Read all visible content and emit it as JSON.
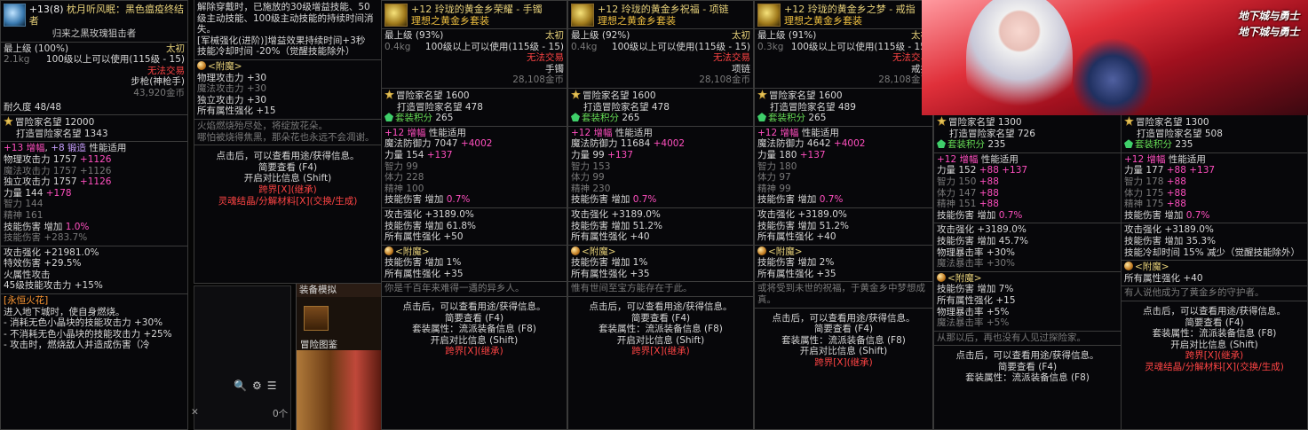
{
  "p1": {
    "title_prefix": "+13(8)",
    "title_name": "枕月听风眠：黑色瘟疫终结者",
    "subtitle": "归来之黑玫瑰狙击者",
    "level": "最上级",
    "level_pct": "(100%)",
    "grade": "太初",
    "weight": "2.1kg",
    "req": "100级以上可以使用(115级 - 15)",
    "trade": "无法交易",
    "type": "步枪(神枪手)",
    "price": "43,920金币",
    "durability": "耐久度 48/48",
    "fame_label": "冒险家名望",
    "fame": "12000",
    "craft_label": "打造冒险家名望",
    "craft": "1343",
    "enh_a": "+13",
    "enh_b": "增幅",
    "enh_c": "+8",
    "enh_d": "锻造",
    "enh_e": "性能适用",
    "stats": [
      {
        "k": "物理攻击力",
        "v": "1757",
        "b": "+1126"
      },
      {
        "k": "魔法攻击力",
        "v": "1757",
        "b": "+1126"
      },
      {
        "k": "独立攻击力",
        "v": "1757",
        "b": "+1126"
      },
      {
        "k": "力量",
        "v": "144",
        "b": "+178"
      },
      {
        "k": "智力",
        "v": "144",
        "b": ""
      },
      {
        "k": "精神",
        "v": "161",
        "b": ""
      }
    ],
    "skill_inc": "技能伤害  增加",
    "skill_inc_v": "1.0%",
    "skill_dmg": "技能伤害",
    "skill_dmg_v": "+283.7%",
    "atk_strong": "攻击强化  +21981.0%",
    "special_dmg": "特效伤害  +29.5%",
    "fire_atk": "火属性攻击",
    "lvl45": "45级技能攻击力  +15%",
    "section": "[永恒火花]",
    "desc1": "进入地下城时，使自身燃烧。",
    "desc2": "- 消耗无色小晶块的技能攻击力 +30%",
    "desc3": "- 不消耗无色小晶块的技能攻击力 +25%",
    "desc4": "- 攻击时，燃烧敌人并造成伤害（冷"
  },
  "p2": {
    "text1": "解除穿戴时，已施放的30级增益技能、50级主动技能、100级主动技能的持续时间消失。",
    "text2": "[军械强化(进阶)]增益效果持续时间+3秒",
    "text3": "技能冷却时间 -20%（觉醒技能除外）",
    "enchant": "<附魔>",
    "e1": "物理攻击力 +30",
    "e2": "魔法攻击力 +30",
    "e3": "独立攻击力 +30",
    "e4": "所有属性强化 +15",
    "flavor1": "火焰燃烧殆尽处，将绽放花朵。",
    "flavor2": "哪怕被烧得焦黑，那朵花也永远不会凋谢。",
    "click": "点击后，可以查看用途/获得信息。",
    "simple": "简要查看 (F4)",
    "compare": "开启对比信息 (Shift)",
    "cross": "跨界[X](继承)",
    "soul": "灵魂结晶/分解材料[X](交换/生成)",
    "equip_sim": "装备模拟",
    "adv_book": "冒险图鉴",
    "count": "0个"
  },
  "items": [
    {
      "title": "+12  玲珑的黄金乡荣耀 - 手镯",
      "set": "理想之黄金乡套装",
      "level_pct": "(93%)",
      "weight": "0.4kg",
      "req": "100级以上可以使用(115级 - 15)",
      "kind": "手镯",
      "price": "28,108金币",
      "fame": "1600",
      "craft": "478",
      "setpts": "265",
      "def_k": "魔法防御力",
      "def_v": "7047",
      "def_b": "+4002",
      "s1k": "力量",
      "s1v": "154",
      "s1b": "+137",
      "s2k": "智力",
      "s2v": "99",
      "s3k": "体力",
      "s3v": "228",
      "s4k": "精神",
      "s4v": "100",
      "skill": "0.7%",
      "atk": "攻击强化  +3189.0%",
      "dmg": "技能伤害  增加  61.8%",
      "all": "所有属性强化  +50",
      "en1": "技能伤害  增加  1%",
      "en2": "所有属性强化  +35",
      "flavor": "你是千百年来难得一遇的异乡人。"
    },
    {
      "title": "+12  玲珑的黄金乡祝福 - 项链",
      "set": "理想之黄金乡套装",
      "level_pct": "(92%)",
      "weight": "0.4kg",
      "req": "100级以上可以使用(115级 - 15)",
      "kind": "项链",
      "price": "28,108金币",
      "fame": "1600",
      "craft": "478",
      "setpts": "265",
      "def_k": "魔法防御力",
      "def_v": "11684",
      "def_b": "+4002",
      "s1k": "力量",
      "s1v": "99",
      "s1b": "+137",
      "s2k": "智力",
      "s2v": "153",
      "s3k": "体力",
      "s3v": "99",
      "s4k": "精神",
      "s4v": "230",
      "skill": "0.7%",
      "atk": "攻击强化  +3189.0%",
      "dmg": "技能伤害  增加  51.2%",
      "all": "所有属性强化  +40",
      "en1": "技能伤害  增加  1%",
      "en2": "所有属性强化  +35",
      "flavor": "惟有世间至宝方能存在于此。"
    },
    {
      "title": "+12  玲珑的黄金乡之梦 - 戒指",
      "set": "理想之黄金乡套装",
      "level_pct": "(91%)",
      "weight": "0.3kg",
      "req": "100级以上可以使用(115级 - 15)",
      "kind": "戒指",
      "price": "28,108金币",
      "fame": "1600",
      "craft": "489",
      "setpts": "265",
      "def_k": "魔法防御力",
      "def_v": "4642",
      "def_b": "+4002",
      "s1k": "力量",
      "s1v": "180",
      "s1b": "+137",
      "s2k": "智力",
      "s2v": "180",
      "s3k": "体力",
      "s3v": "97",
      "s4k": "精神",
      "s4v": "99",
      "skill": "0.7%",
      "atk": "攻击强化  +3189.0%",
      "dmg": "技能伤害  增加  51.2%",
      "all": "所有属性强化  +40",
      "en1": "技能伤害  增加  2%",
      "en2": "所有属性强化  +35",
      "flavor": "或将受到未世的祝福，于黄金乡中梦想成真。"
    }
  ],
  "p6": {
    "fame": "1300",
    "craft": "726",
    "setpts": "235",
    "enh": "+12",
    "stats": [
      {
        "k": "力量",
        "v": "152",
        "b": "+88  +137"
      },
      {
        "k": "智力",
        "v": "150",
        "b": "+88"
      },
      {
        "k": "体力",
        "v": "147",
        "b": "+88"
      },
      {
        "k": "精神",
        "v": "151",
        "b": "+88"
      }
    ],
    "skill": "0.7%",
    "atk": "攻击强化  +3189.0%",
    "dmg": "技能伤害  增加  45.7%",
    "phys_crit": "物理暴击率  +30%",
    "mag_crit": "魔法暴击率  +30%",
    "en1": "技能伤害  增加  7%",
    "en2": "所有属性强化  +15",
    "en3": "物理暴击率  +5%",
    "en4": "魔法暴击率  +5%",
    "flavor": "从那以后，再也没有人见过探险家。",
    "setattr": "套装属性：流派装备信息 (F8)"
  },
  "p7": {
    "fame": "1300",
    "craft": "508",
    "setpts": "235",
    "enh": "+12",
    "stats": [
      {
        "k": "力量",
        "v": "177",
        "b": "+88  +137"
      },
      {
        "k": "智力",
        "v": "178",
        "b": "+88"
      },
      {
        "k": "体力",
        "v": "175",
        "b": "+88"
      },
      {
        "k": "精神",
        "v": "175",
        "b": "+88"
      }
    ],
    "skill": "0.7%",
    "atk": "攻击强化  +3189.0%",
    "dmg": "技能伤害  增加  35.3%",
    "cd": "技能冷却时间 15% 减少（觉醒技能除外）",
    "en1": "所有属性强化  +40",
    "flavor": "有人说他成为了黄金乡的守护者。"
  },
  "common": {
    "top_level": "最上级",
    "grade": "太初",
    "trade": "无法交易",
    "fame_label": "冒险家名望",
    "craft_label": "打造冒险家名望",
    "setpts_label": "套装积分",
    "enh_label": "增幅",
    "perf": "性能适用",
    "skill_label": "技能伤害  增加",
    "enchant": "<附魔>",
    "click": "点击后，可以查看用途/获得信息。",
    "simple": "简要查看 (F4)",
    "setattr": "套装属性：流派装备信息 (F8)",
    "compare": "开启对比信息 (Shift)",
    "cross": "跨界[X](继承)",
    "soul": "灵魂结晶/分解材料[X](交换/生成)",
    "logo": "地下城与勇士"
  },
  "colors": {
    "gold": "#f0c040",
    "pink": "#ff4fbf",
    "red": "#ff4444",
    "panel": "#07070a"
  }
}
